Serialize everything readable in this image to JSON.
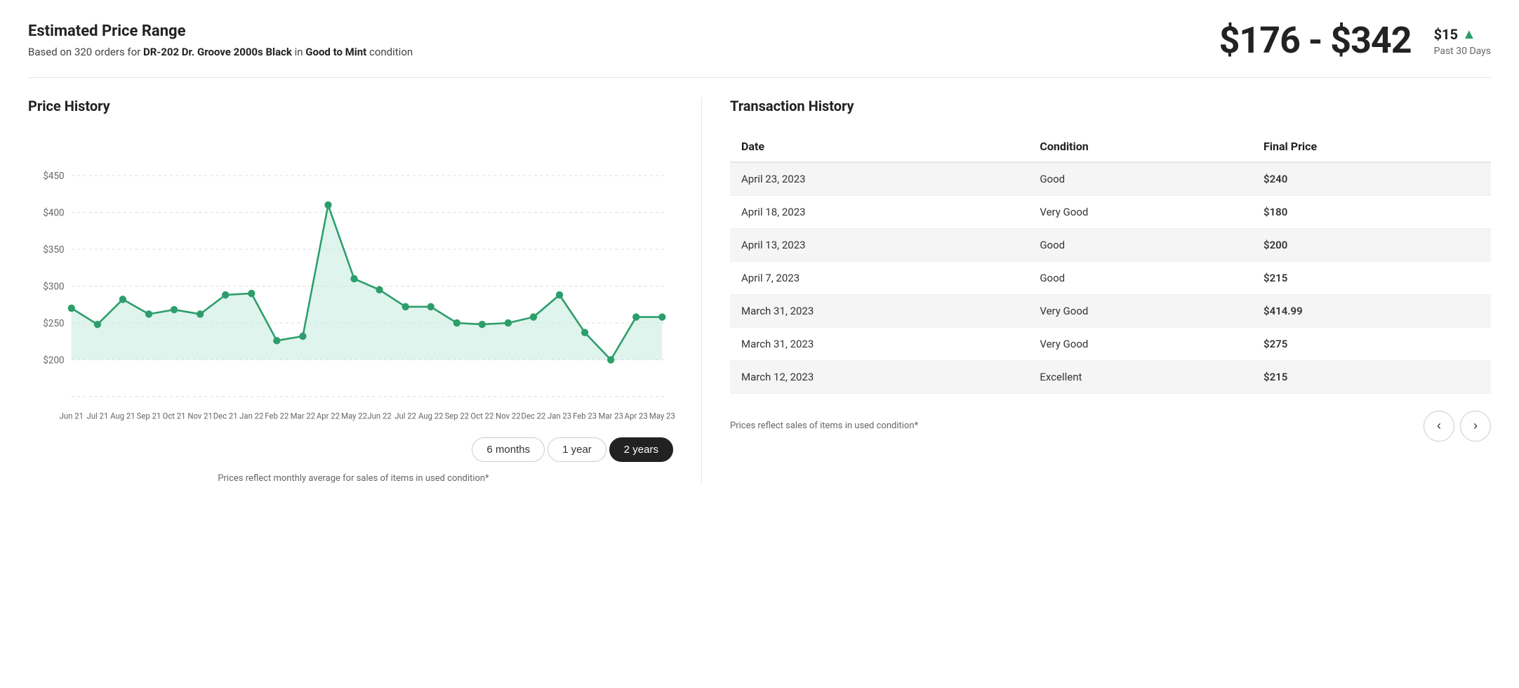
{
  "header": {
    "title": "Estimated Price Range",
    "subtitle_prefix": "Based on 320 orders for ",
    "subtitle_item": "DR-202 Dr. Groove 2000s Black",
    "subtitle_middle": " in ",
    "subtitle_condition": "Good to Mint",
    "subtitle_suffix": " condition",
    "price_range": "$176 - $342",
    "price_change": "$15",
    "price_change_label": "Past 30 Days"
  },
  "price_history": {
    "title": "Price History",
    "y_axis_labels": [
      "$450",
      "$400",
      "$350",
      "$300",
      "$250",
      "$200"
    ],
    "x_axis_labels": [
      "Jun 21",
      "Jul 21",
      "Aug 21",
      "Sep 21",
      "Oct 21",
      "Nov 21",
      "Dec 21",
      "Jan 22",
      "Feb 22",
      "Mar 22",
      "Apr 22",
      "May 22",
      "Jun 22",
      "Jul 22",
      "Aug 22",
      "Sep 22",
      "Oct 22",
      "Nov 22",
      "Dec 22",
      "Jan 23",
      "Feb 23",
      "Mar 23",
      "Apr 23",
      "May 23"
    ],
    "footnote": "Prices reflect monthly average for sales of items in used condition*",
    "time_buttons": [
      {
        "label": "6 months",
        "active": false
      },
      {
        "label": "1 year",
        "active": false
      },
      {
        "label": "2 years",
        "active": true
      }
    ]
  },
  "transaction_history": {
    "title": "Transaction History",
    "columns": [
      "Date",
      "Condition",
      "Final Price"
    ],
    "rows": [
      {
        "date": "April 23, 2023",
        "condition": "Good",
        "price": "$240"
      },
      {
        "date": "April 18, 2023",
        "condition": "Very Good",
        "price": "$180"
      },
      {
        "date": "April 13, 2023",
        "condition": "Good",
        "price": "$200"
      },
      {
        "date": "April 7, 2023",
        "condition": "Good",
        "price": "$215"
      },
      {
        "date": "March 31, 2023",
        "condition": "Very Good",
        "price": "$414.99"
      },
      {
        "date": "March 31, 2023",
        "condition": "Very Good",
        "price": "$275"
      },
      {
        "date": "March 12, 2023",
        "condition": "Excellent",
        "price": "$215"
      }
    ],
    "footnote": "Prices reflect sales of items in used condition*",
    "pagination": {
      "prev_label": "‹",
      "next_label": "›"
    }
  }
}
